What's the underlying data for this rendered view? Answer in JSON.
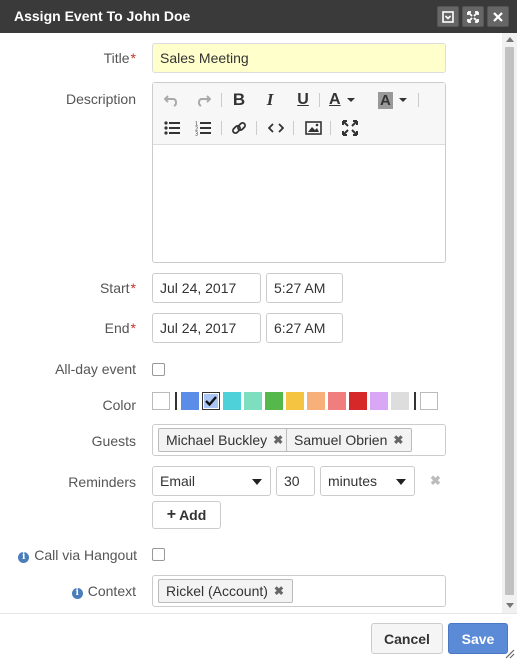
{
  "window": {
    "title": "Assign Event To John Doe"
  },
  "form": {
    "title": {
      "label": "Title",
      "value": "Sales Meeting"
    },
    "description": {
      "label": "Description",
      "value": ""
    },
    "start": {
      "label": "Start",
      "date": "Jul 24, 2017",
      "time": "5:27 AM"
    },
    "end": {
      "label": "End",
      "date": "Jul 24, 2017",
      "time": "6:27 AM"
    },
    "all_day": {
      "label": "All-day event",
      "checked": false
    },
    "color": {
      "label": "Color",
      "swatches": [
        "#ffffff",
        "#5b8de8",
        "#a9c4f5",
        "#4fd1d9",
        "#7ddfbf",
        "#55b84a",
        "#f5c542",
        "#f7b07a",
        "#f07e7e",
        "#d62828",
        "#d9a7f5",
        "#dddddd",
        "#ffffff"
      ],
      "selected_index": 2
    },
    "guests": {
      "label": "Guests",
      "items": [
        "Michael Buckley",
        "Samuel Obrien"
      ]
    },
    "reminders": {
      "label": "Reminders",
      "type": "Email",
      "amount": "30",
      "unit": "minutes",
      "add_label": "Add"
    },
    "hangout": {
      "label": "Call via Hangout",
      "checked": false
    },
    "context": {
      "label": "Context",
      "items": [
        "Rickel (Account)"
      ]
    }
  },
  "footer": {
    "cancel_label": "Cancel",
    "save_label": "Save"
  },
  "colors": {
    "titlebar": "#3a3a3a",
    "required": "#c9302c",
    "primary": "#5b8ad6"
  }
}
